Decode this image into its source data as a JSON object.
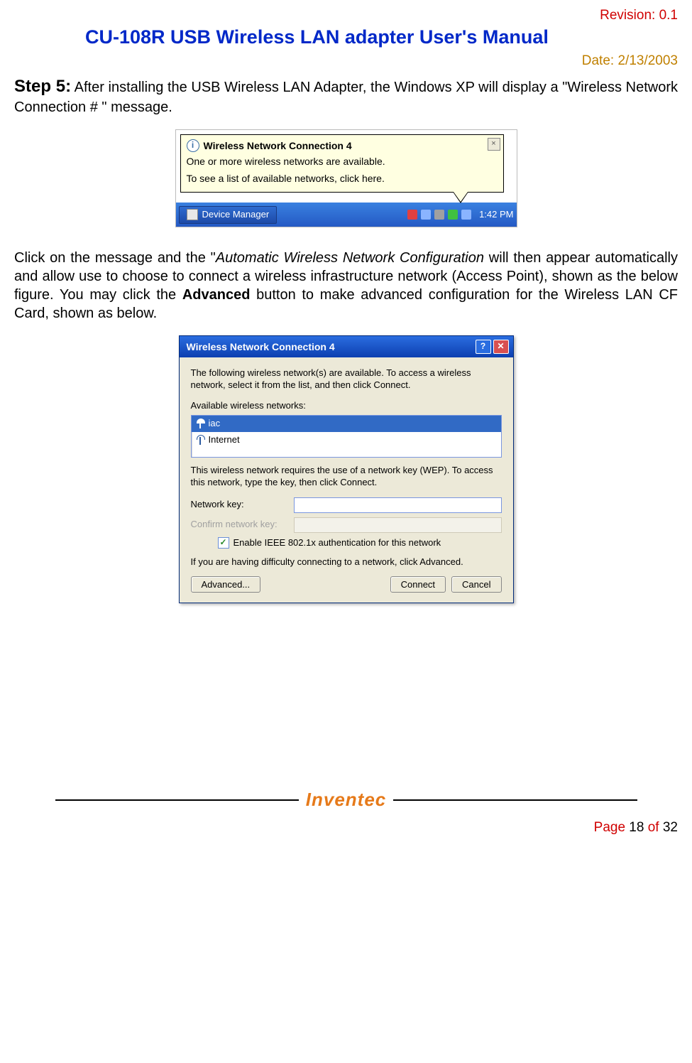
{
  "header": {
    "revision_label": "Revision:",
    "revision_value": "0.1",
    "title": "CU-108R USB Wireless LAN adapter User's Manual",
    "date_label": "Date:",
    "date_value": "2/13/2003"
  },
  "body": {
    "step_label": "Step 5:",
    "step_text": " After installing the USB Wireless LAN Adapter, the Windows XP will display a \"Wireless Network Connection # \" message.",
    "para2_a": "Click on the message and the \"",
    "para2_italic": "Automatic Wireless Network Configuration",
    "para2_b": " will then appear automatically and allow use to choose to connect a wireless infrastructure network (Access Point), shown as the below figure.  You may click the ",
    "para2_bold": "Advanced",
    "para2_c": " button to make advanced configuration for the Wireless LAN CF Card, shown as below."
  },
  "balloon": {
    "title": "Wireless Network Connection 4",
    "line1": "One or more wireless networks are available.",
    "line2": "To see a list of available networks, click here.",
    "taskbar_button": "Device Manager",
    "clock": "1:42 PM"
  },
  "dialog": {
    "title": "Wireless Network Connection 4",
    "intro": "The following wireless network(s) are available. To access a wireless network, select it from the list, and then click Connect.",
    "available_label": "Available wireless networks:",
    "networks": [
      "iac",
      "Internet"
    ],
    "wep_text": "This wireless network requires the use of a network key (WEP). To access this network, type the key, then click Connect.",
    "key_label": "Network key:",
    "confirm_label": "Confirm network key:",
    "chk_label": "Enable IEEE 802.1x authentication for this network",
    "adv_text": "If you are having difficulty connecting to a network, click Advanced.",
    "btn_advanced": "Advanced...",
    "btn_connect": "Connect",
    "btn_cancel": "Cancel"
  },
  "footer": {
    "logo": "Inventec",
    "page_label": "Page",
    "page_num": "18",
    "of_label": "of",
    "page_total": "32"
  }
}
